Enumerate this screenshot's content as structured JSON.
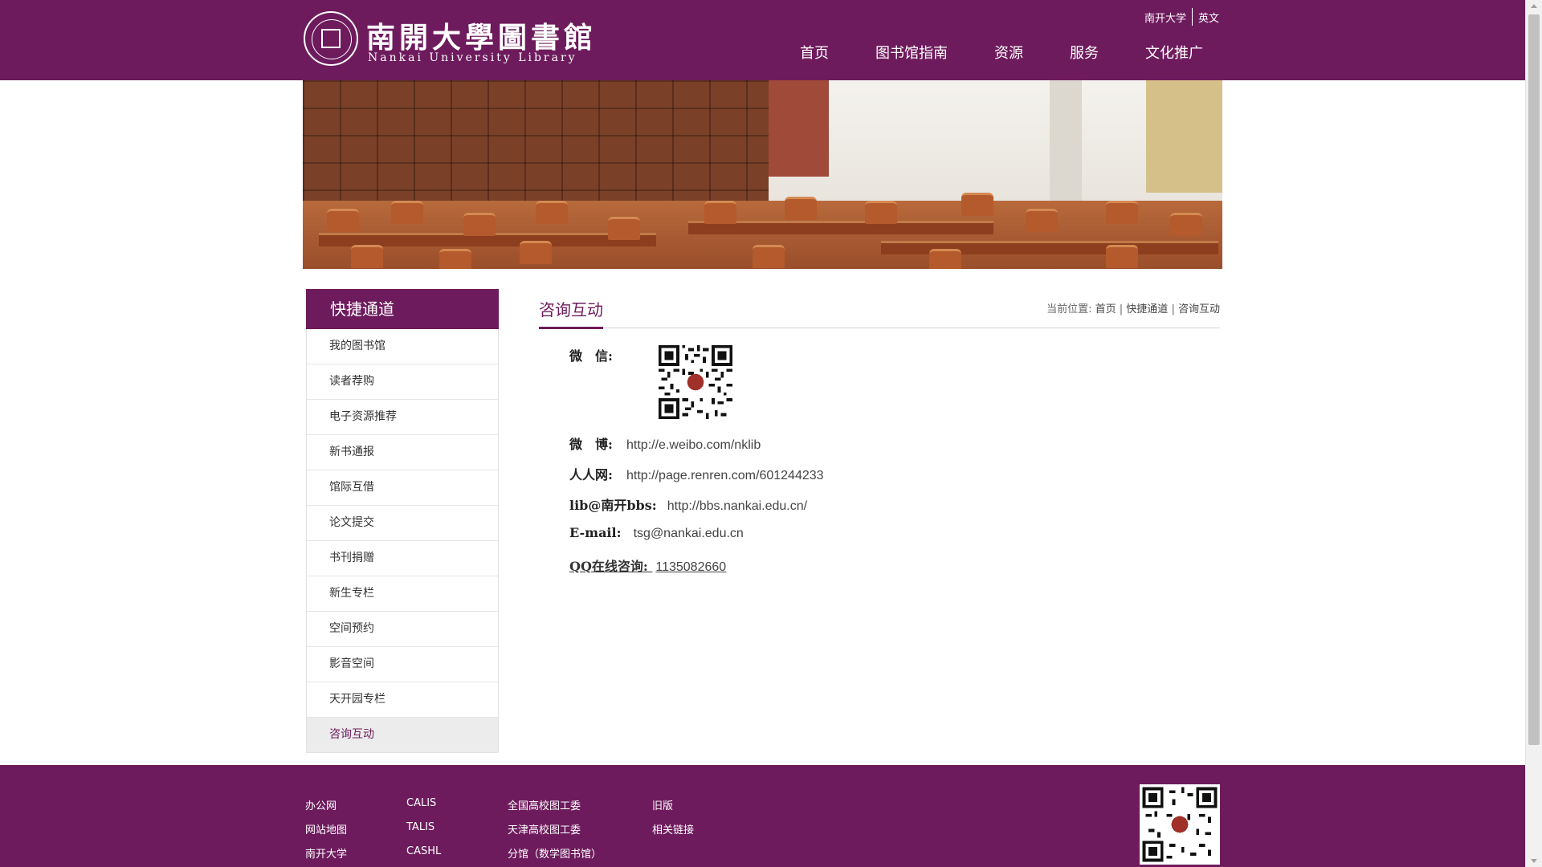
{
  "header": {
    "logo_cn": "南開大學圖書館",
    "logo_en": "Nankai University Library",
    "top_links": [
      "南开大学",
      "英文"
    ],
    "nav": [
      "首页",
      "图书馆指南",
      "资源",
      "服务",
      "文化推广"
    ]
  },
  "sidebar": {
    "title": "快捷通道",
    "items": [
      {
        "label": "我的图书馆"
      },
      {
        "label": "读者荐购"
      },
      {
        "label": "电子资源推荐"
      },
      {
        "label": "新书通报"
      },
      {
        "label": "馆际互借"
      },
      {
        "label": "论文提交"
      },
      {
        "label": "书刊捐赠"
      },
      {
        "label": "新生专栏"
      },
      {
        "label": "空间预约"
      },
      {
        "label": "影音空间"
      },
      {
        "label": "天开园专栏"
      },
      {
        "label": "咨询互动"
      }
    ],
    "active_index": 11
  },
  "content": {
    "title": "咨询互动",
    "breadcrumb": {
      "prefix": "当前位置:",
      "items": [
        "首页",
        "快捷通道",
        "咨询互动"
      ],
      "separator": "|"
    },
    "rows": {
      "wechat": {
        "label": "微　信:"
      },
      "weibo": {
        "label": "微　博:",
        "value": "http://e.weibo.com/nklib"
      },
      "renren": {
        "label": "人人网:",
        "value": "http://page.renren.com/601244233"
      },
      "bbs": {
        "label": "lib@南开bbs:",
        "value": "http://bbs.nankai.edu.cn/"
      },
      "email": {
        "label": "E-mail:",
        "value": "tsg@nankai.edu.cn"
      },
      "qq": {
        "label": "QQ在线咨询:",
        "value": "1135082660"
      }
    }
  },
  "footer": {
    "columns": [
      [
        "办公网",
        "网站地图",
        "南开大学"
      ],
      [
        "CALIS",
        "TALIS",
        "CASHL"
      ],
      [
        "全国高校图工委",
        "天津高校图工委",
        "分馆（数学图书馆）"
      ],
      [
        "旧版",
        "相关链接"
      ]
    ]
  },
  "colors": {
    "brand": "#6e1b5d",
    "link": "#444444"
  },
  "icons": [
    "seal-logo-icon",
    "qr-code-icon"
  ]
}
